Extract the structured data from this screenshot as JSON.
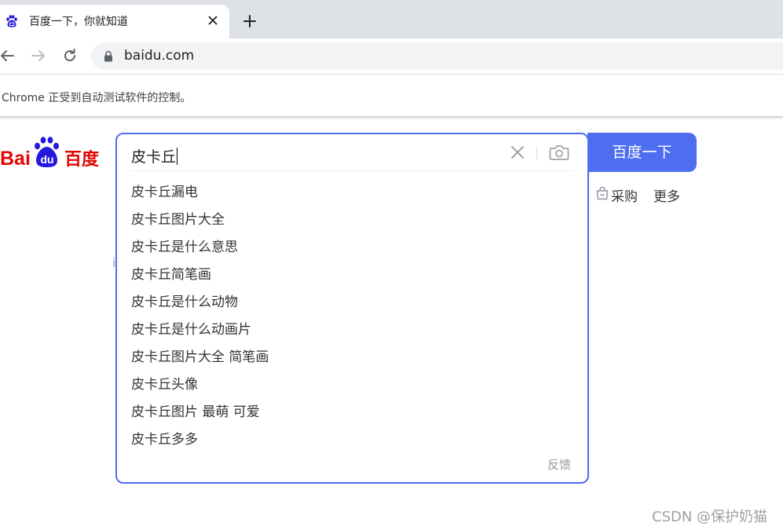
{
  "tab": {
    "title": "百度一下，你就知道",
    "favicon": "baidu-paw-icon"
  },
  "toolbar": {
    "url": "baidu.com"
  },
  "infobar": {
    "text": "Chrome 正受到自动测试软件的控制。"
  },
  "logo": {
    "bai": "Bai",
    "du": "du",
    "baidu_cn": "百度"
  },
  "search": {
    "query": "皮卡丘",
    "button_label": "百度一下",
    "suggestions": [
      "皮卡丘漏电",
      "皮卡丘图片大全",
      "皮卡丘是什么意思",
      "皮卡丘简笔画",
      "皮卡丘是什么动物",
      "皮卡丘是什么动画片",
      "皮卡丘图片大全 简笔画",
      "皮卡丘头像",
      "皮卡丘图片 最萌 可爱",
      "皮卡丘多多"
    ],
    "feedback": "反馈"
  },
  "right_links": {
    "purchase": "采购",
    "more": "更多"
  },
  "partial_text": "i",
  "watermark": "CSDN @保护奶猫",
  "colors": {
    "accent": "#4e6ef2",
    "baidu_red": "#e10602",
    "baidu_blue": "#2319dc",
    "tabbar_bg": "#dee1e6"
  }
}
